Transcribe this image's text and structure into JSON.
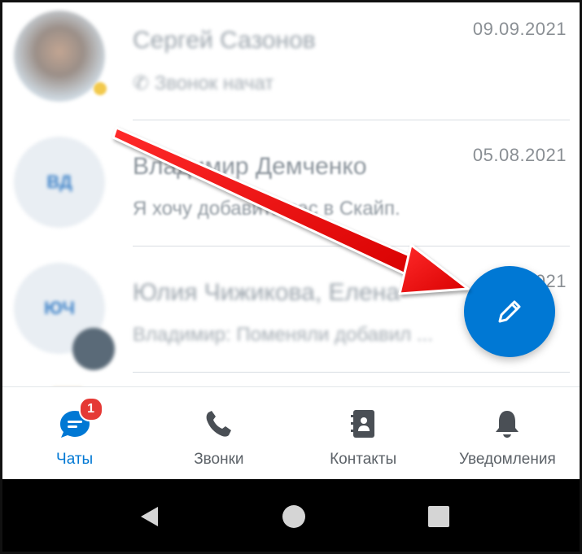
{
  "chats": [
    {
      "name": "Сергей Сазонов",
      "preview": "Звонок начат",
      "date": "09.09.2021",
      "avatar_initials": ""
    },
    {
      "name": "Владимир Демченко",
      "preview": "Я хочу добавить вас в Скайп.",
      "date": "05.08.2021",
      "avatar_initials": "ВД"
    },
    {
      "name": "Юлия Чижикова, Елена",
      "preview": "Владимир: Поменяли добавил ...",
      "date": "021",
      "avatar_initials": "ЮЧ"
    }
  ],
  "fab": {
    "icon": "pencil-icon"
  },
  "bottom_nav": {
    "items": [
      {
        "label": "Чаты",
        "icon": "chat-icon",
        "badge": "1",
        "active": true
      },
      {
        "label": "Звонки",
        "icon": "phone-icon"
      },
      {
        "label": "Контакты",
        "icon": "contacts-book-icon"
      },
      {
        "label": "Уведомления",
        "icon": "bell-icon"
      }
    ]
  },
  "system_nav": {
    "buttons": [
      "back-icon",
      "home-icon",
      "recents-icon"
    ]
  },
  "colors": {
    "accent": "#0078d4",
    "badge": "#e53935",
    "arrow": "#ee1111"
  }
}
